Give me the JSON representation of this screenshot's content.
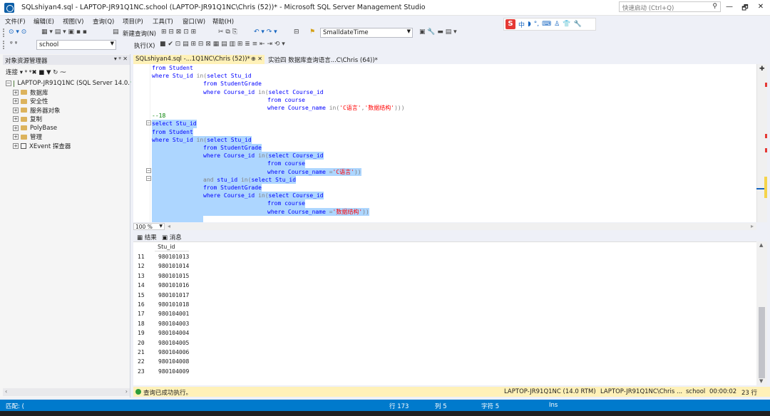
{
  "window": {
    "title": "SQLshiyan4.sql - LAPTOP-JR91Q1NC.school (LAPTOP-JR91Q1NC\\Chris (52))* - Microsoft SQL Server Management Studio",
    "quick_launch": "快速启动 (Ctrl+Q)",
    "controls": [
      "—",
      "🗗",
      "✕"
    ]
  },
  "menu": [
    "文件(F)",
    "编辑(E)",
    "视图(V)",
    "查询(Q)",
    "项目(P)",
    "工具(T)",
    "窗口(W)",
    "帮助(H)"
  ],
  "toolbar": {
    "new_query": "新建查询(N)",
    "type_combo": "SmalldateTime",
    "database_combo": "school",
    "execute": "执行(X)"
  },
  "ime": {
    "logo": "S",
    "glyphs": [
      "中",
      "◗",
      "°,",
      "⌨",
      "♙",
      "👕",
      "🔧"
    ]
  },
  "object_explorer": {
    "title": "对象资源管理器",
    "header_buttons": "▾ ᵠ ✕",
    "connect": "连接",
    "toolbar_icons": "▾ ᵠ ᵠ✖ ■ ▼ ↻ ⁓",
    "server": "LAPTOP-JR91Q1NC (SQL Server 14.0.",
    "nodes": [
      "数据库",
      "安全性",
      "服务器对象",
      "复制",
      "PolyBase",
      "管理",
      "XEvent 探查器"
    ]
  },
  "tabs": {
    "active": "SQLshiyan4.sql -...1Q1NC\\Chris (52))*",
    "active_pin": "⊕ ✕",
    "inactive": "实验四 数据库查询语言...C\\Chris (64))*"
  },
  "code": [
    {
      "t": [
        [
          "from Student",
          "kw"
        ]
      ],
      "sel": false,
      "indent": 0
    },
    {
      "t": [
        [
          "where Stu_id ",
          "kw"
        ],
        [
          "in",
          "gy"
        ],
        [
          "(",
          "gy"
        ],
        [
          "select Stu_id",
          "kw"
        ]
      ],
      "sel": false,
      "indent": 0
    },
    {
      "t": [
        [
          "from StudentGrade",
          "kw"
        ]
      ],
      "sel": false,
      "indent": 1
    },
    {
      "t": [
        [
          "where Course_id ",
          "kw"
        ],
        [
          "in",
          "gy"
        ],
        [
          "(",
          "gy"
        ],
        [
          "select Course_id",
          "kw"
        ]
      ],
      "sel": false,
      "indent": 1
    },
    {
      "t": [
        [
          "from course",
          "kw"
        ]
      ],
      "sel": false,
      "indent": 2
    },
    {
      "t": [
        [
          "where Course_name ",
          "kw"
        ],
        [
          "in",
          "gy"
        ],
        [
          "(",
          "gy"
        ],
        [
          "'C语言'",
          "str"
        ],
        [
          ",",
          "gy"
        ],
        [
          "'数据结构'",
          "str"
        ],
        [
          ")))",
          "gy"
        ]
      ],
      "sel": false,
      "indent": 2
    },
    {
      "t": [
        [
          "--18",
          "cm"
        ]
      ],
      "sel": false,
      "indent": 0
    },
    {
      "t": [
        [
          "select Stu_id",
          "kw"
        ]
      ],
      "sel": true,
      "indent": 0
    },
    {
      "t": [
        [
          "from Student",
          "kw"
        ]
      ],
      "sel": true,
      "indent": 0
    },
    {
      "t": [
        [
          "where Stu_id ",
          "kw"
        ],
        [
          "in",
          "gy"
        ],
        [
          "(",
          "gy"
        ],
        [
          "select Stu_id",
          "kw"
        ]
      ],
      "sel": true,
      "indent": 0
    },
    {
      "t": [
        [
          "from StudentGrade",
          "kw"
        ]
      ],
      "sel": true,
      "indent": 1
    },
    {
      "t": [
        [
          "where Course_id ",
          "kw"
        ],
        [
          "in",
          "gy"
        ],
        [
          "(",
          "gy"
        ],
        [
          "select Course_id",
          "kw"
        ]
      ],
      "sel": true,
      "indent": 1
    },
    {
      "t": [
        [
          "from course",
          "kw"
        ]
      ],
      "sel": true,
      "indent": 2
    },
    {
      "t": [
        [
          "where Course_name ",
          "kw"
        ],
        [
          "=",
          "gy"
        ],
        [
          "'C语言'",
          "str"
        ],
        [
          "))",
          "gy"
        ]
      ],
      "sel": true,
      "indent": 2
    },
    {
      "t": [
        [
          "and ",
          "gy"
        ],
        [
          "stu_id ",
          "kw"
        ],
        [
          "in",
          "gy"
        ],
        [
          "(",
          "gy"
        ],
        [
          "select Stu_id",
          "kw"
        ]
      ],
      "sel": true,
      "indent": 1
    },
    {
      "t": [
        [
          "from StudentGrade",
          "kw"
        ]
      ],
      "sel": true,
      "indent": 1
    },
    {
      "t": [
        [
          "where Course_id ",
          "kw"
        ],
        [
          "in",
          "gy"
        ],
        [
          "(",
          "gy"
        ],
        [
          "select Course_id",
          "kw"
        ]
      ],
      "sel": true,
      "indent": 1
    },
    {
      "t": [
        [
          "from course",
          "kw"
        ]
      ],
      "sel": true,
      "indent": 2
    },
    {
      "t": [
        [
          "where Course_name ",
          "kw"
        ],
        [
          "=",
          "gy"
        ],
        [
          "'数据结构'",
          "str"
        ],
        [
          "))",
          "gy"
        ]
      ],
      "sel": true,
      "indent": 2
    },
    {
      "t": [
        [
          "",
          "kw"
        ]
      ],
      "sel": true,
      "indent": 1
    }
  ],
  "zoom": "100 %",
  "results": {
    "tabs": [
      "结果",
      "消息"
    ],
    "column": "Stu_id",
    "rows": [
      {
        "n": "11",
        "v": "980101013"
      },
      {
        "n": "12",
        "v": "980101014"
      },
      {
        "n": "13",
        "v": "980101015"
      },
      {
        "n": "14",
        "v": "980101016"
      },
      {
        "n": "15",
        "v": "980101017"
      },
      {
        "n": "16",
        "v": "980101018"
      },
      {
        "n": "17",
        "v": "980104001"
      },
      {
        "n": "18",
        "v": "980104003"
      },
      {
        "n": "19",
        "v": "980104004"
      },
      {
        "n": "20",
        "v": "980104005"
      },
      {
        "n": "21",
        "v": "980104006"
      },
      {
        "n": "22",
        "v": "980104008"
      },
      {
        "n": "23",
        "v": "980104009"
      }
    ]
  },
  "result_status": {
    "message": "查询已成功执行。",
    "server": "LAPTOP-JR91Q1NC (14.0 RTM)",
    "user": "LAPTOP-JR91Q1NC\\Chris ...",
    "database": "school",
    "elapsed": "00:00:02",
    "rows": "23 行"
  },
  "statusbar": {
    "left": "匹配: (",
    "line": "行 173",
    "col": "列 5",
    "char": "字符 5",
    "mode": "Ins"
  },
  "colors": {
    "accent": "#007acc",
    "selection": "#add6ff",
    "tab_active": "#fff1b8"
  }
}
